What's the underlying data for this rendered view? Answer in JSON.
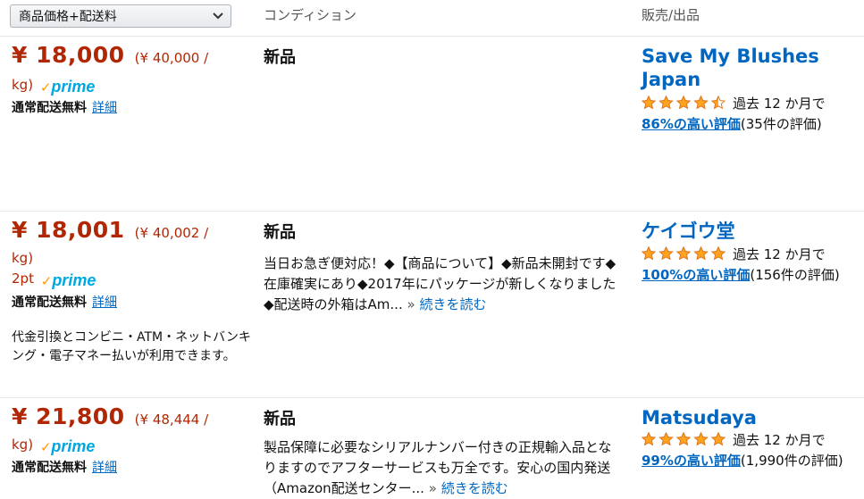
{
  "sort": {
    "selected": "商品価格+配送料"
  },
  "headers": {
    "condition": "コンディション",
    "seller": "販売/出品"
  },
  "offers": [
    {
      "price": "¥ 18,000",
      "unit_price_a": "(¥ 40,000 /",
      "unit_price_b": "kg)",
      "points": "",
      "prime_check": "✓",
      "prime_word": "prime",
      "shipping": "通常配送無料",
      "details": "詳細",
      "extra": "",
      "condition": "新品",
      "condition_desc": "",
      "more": "",
      "seller": "Save My Blushes Japan",
      "stars": 4.5,
      "rating_period": "過去 12 か月で",
      "positive": "86%の高い評価",
      "count": "(35件の評価)"
    },
    {
      "price": "¥ 18,001",
      "unit_price_a": "(¥ 40,002 /",
      "unit_price_b": "kg)",
      "points": "2pt",
      "prime_check": "✓",
      "prime_word": "prime",
      "shipping": "通常配送無料",
      "details": "詳細",
      "extra": "代金引換とコンビニ・ATM・ネットバンキング・電子マネー払いが利用できます。",
      "condition": "新品",
      "condition_desc": "当日お急ぎ便対応！◆【商品について】◆新品未開封です◆在庫確実にあり◆2017年にパッケージが新しくなりました◆配送時の外箱はAm...",
      "more": "続きを読む",
      "seller": "ケイゴウ堂",
      "stars": 5,
      "rating_period": "過去 12 か月で",
      "positive": "100%の高い評価",
      "count": "(156件の評価)"
    },
    {
      "price": "¥ 21,800",
      "unit_price_a": "(¥ 48,444 /",
      "unit_price_b": "kg)",
      "points": "",
      "prime_check": "✓",
      "prime_word": "prime",
      "shipping": "通常配送無料",
      "details": "詳細",
      "extra": "",
      "condition": "新品",
      "condition_desc": "製品保障に必要なシリアルナンバー付きの正規輸入品となりますのでアフターサービスも万全です。安心の国内発送（Amazon配送センター...",
      "more": "続きを読む",
      "seller": "Matsudaya",
      "stars": 5,
      "rating_period": "過去 12 か月で",
      "positive": "99%の高い評価",
      "count": "(1,990件の評価)"
    }
  ]
}
